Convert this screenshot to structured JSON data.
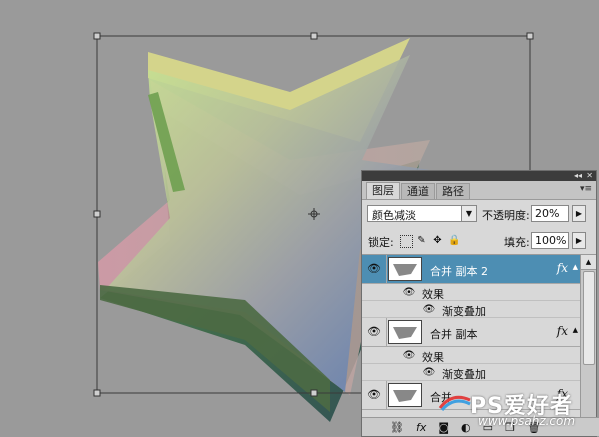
{
  "panel": {
    "tabs": [
      "图层",
      "通道",
      "路径"
    ],
    "blend_mode": "颜色减淡",
    "opacity_label": "不透明度:",
    "opacity_value": "20%",
    "lock_label": "锁定:",
    "fill_label": "填充:",
    "fill_value": "100%",
    "layers": [
      {
        "name": "合并 副本 2",
        "selected": true,
        "fx": "fx"
      },
      {
        "name": "合并 副本",
        "selected": false,
        "fx": "fx"
      },
      {
        "name": "合并",
        "selected": false,
        "fx": "fx"
      }
    ],
    "effects_label": "效果",
    "gradient_overlay_label": "渐变叠加",
    "bottom_fx": "fx"
  },
  "watermark": {
    "main": "PS爱好者",
    "sub": "www.psahz.com"
  },
  "colors": {
    "canvas_bg": "#9a9a9a",
    "selected_layer": "#4d8eb3"
  }
}
